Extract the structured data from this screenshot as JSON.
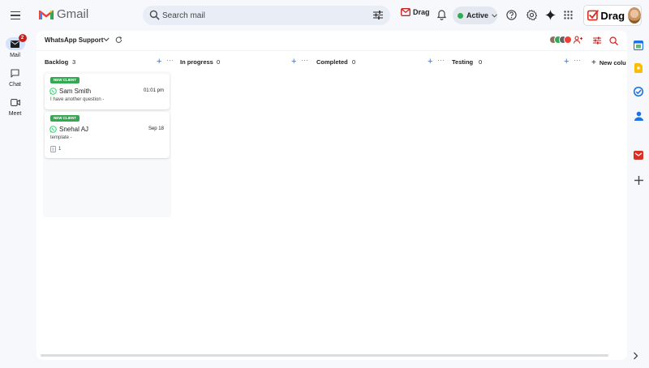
{
  "app": {
    "name": "Gmail"
  },
  "search": {
    "placeholder": "Search mail"
  },
  "toolbar": {
    "drag_label": "Drag",
    "status_label": "Active",
    "brand_label": "Drag"
  },
  "rail": {
    "mail_label": "Mail",
    "mail_badge": "2",
    "chat_label": "Chat",
    "meet_label": "Meet"
  },
  "board": {
    "title": "WhatsApp Support",
    "new_column_label": "New colu",
    "columns": [
      {
        "name": "Backlog",
        "count": "3",
        "cards": [
          {
            "tag": "NEW CLIENT",
            "name": "Sam Smith",
            "time": "01:01 pm",
            "snippet": "I have another question -"
          },
          {
            "tag": "NEW CLIENT",
            "name": "Snehal AJ",
            "time": "Sep 18",
            "snippet": "template -",
            "task_count": "1"
          }
        ]
      },
      {
        "name": "In progress",
        "count": "0"
      },
      {
        "name": "Completed",
        "count": "0"
      },
      {
        "name": "Testing",
        "count": "0"
      }
    ]
  },
  "colors": {
    "accent": "#1a73e8",
    "tag_green": "#34a853",
    "badge_red": "#c5221f",
    "gmail_red": "#ea4335"
  },
  "icons": {
    "menu": "menu-icon",
    "search": "search-icon",
    "tune": "tune-icon",
    "bell": "bell-icon",
    "help": "help-icon",
    "settings": "gear-icon",
    "gemini": "sparkle-icon",
    "apps": "apps-grid-icon",
    "whatsapp": "whatsapp-icon"
  }
}
